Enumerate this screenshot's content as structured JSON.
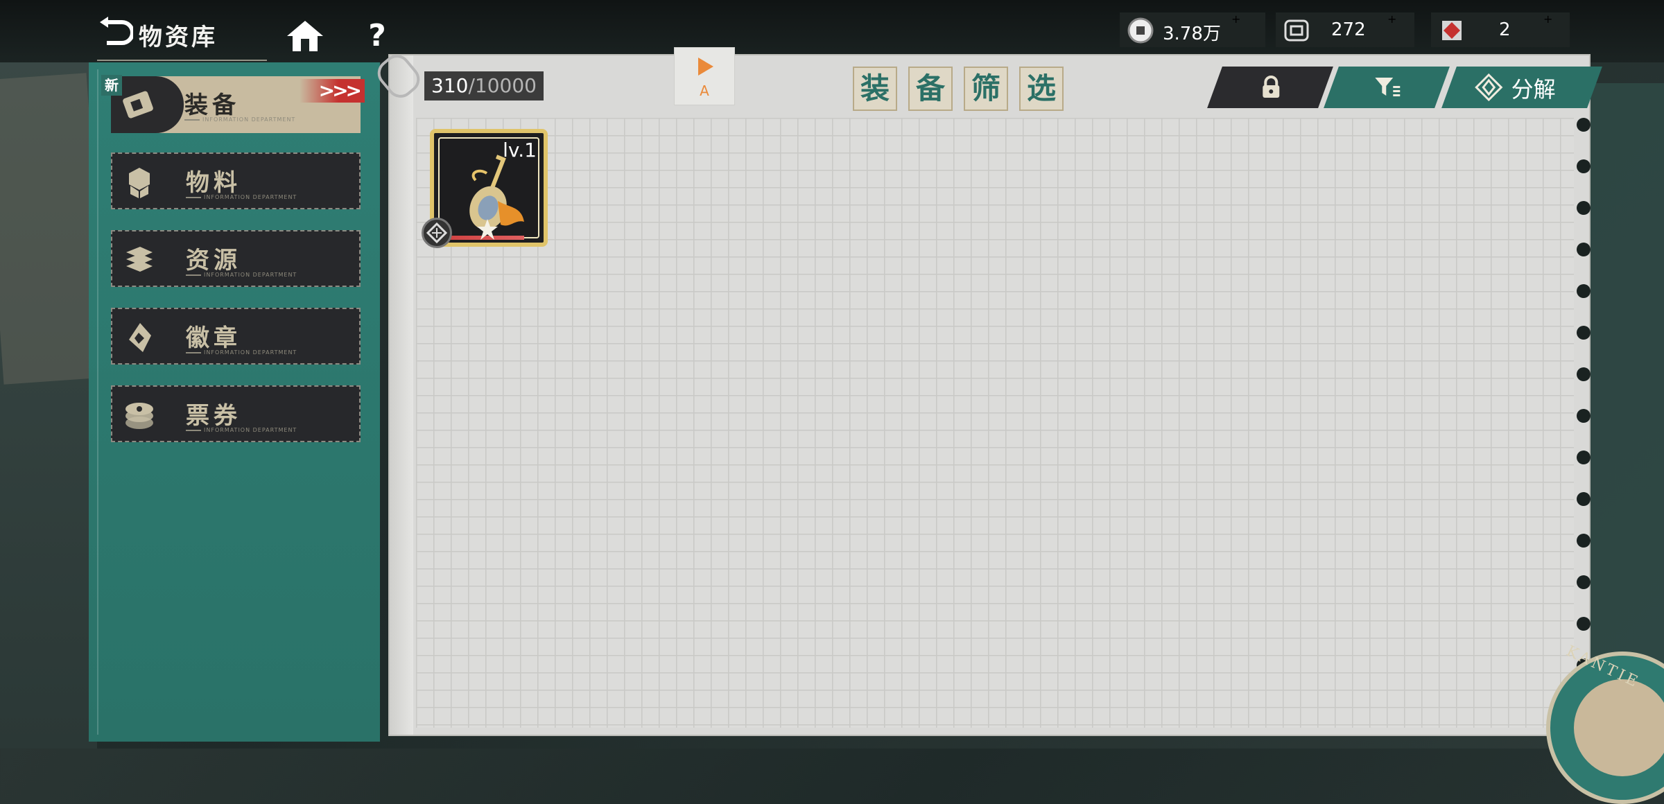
{
  "header": {
    "title": "物资库",
    "help_label": "?"
  },
  "resources": [
    {
      "name": "coin",
      "value": "3.78万",
      "icon": "coin-icon",
      "add": "+"
    },
    {
      "name": "ticket",
      "value": "272",
      "icon": "ticket-icon",
      "add": "+"
    },
    {
      "name": "crystal",
      "value": "2",
      "icon": "crystal-icon",
      "add": "+"
    }
  ],
  "sidebar": {
    "new_badge": "新",
    "items": [
      {
        "label": "装备",
        "sub": "INFORMATION DEPARTMENT",
        "icon": "equipment-icon",
        "active": true
      },
      {
        "label": "物料",
        "sub": "INFORMATION DEPARTMENT",
        "icon": "materials-icon",
        "active": false
      },
      {
        "label": "资源",
        "sub": "INFORMATION DEPARTMENT",
        "icon": "resources-icon",
        "active": false
      },
      {
        "label": "徽章",
        "sub": "INFORMATION DEPARTMENT",
        "icon": "badge-icon",
        "active": false
      },
      {
        "label": "票券",
        "sub": "INFORMATION DEPARTMENT",
        "icon": "voucher-icon",
        "active": false
      }
    ],
    "active_arrows": ">>>"
  },
  "inventory": {
    "count": "310",
    "separator": "/",
    "capacity": "10000",
    "sort_tab_label": "A",
    "filter_title": [
      "装",
      "备",
      "筛",
      "选"
    ],
    "decompose_label": "分解",
    "items": [
      {
        "level": "lv.1",
        "rarity_color": "#e0c46a",
        "icon": "pipa-instrument-icon"
      }
    ]
  },
  "emblem": {
    "text": "KANTIE"
  }
}
